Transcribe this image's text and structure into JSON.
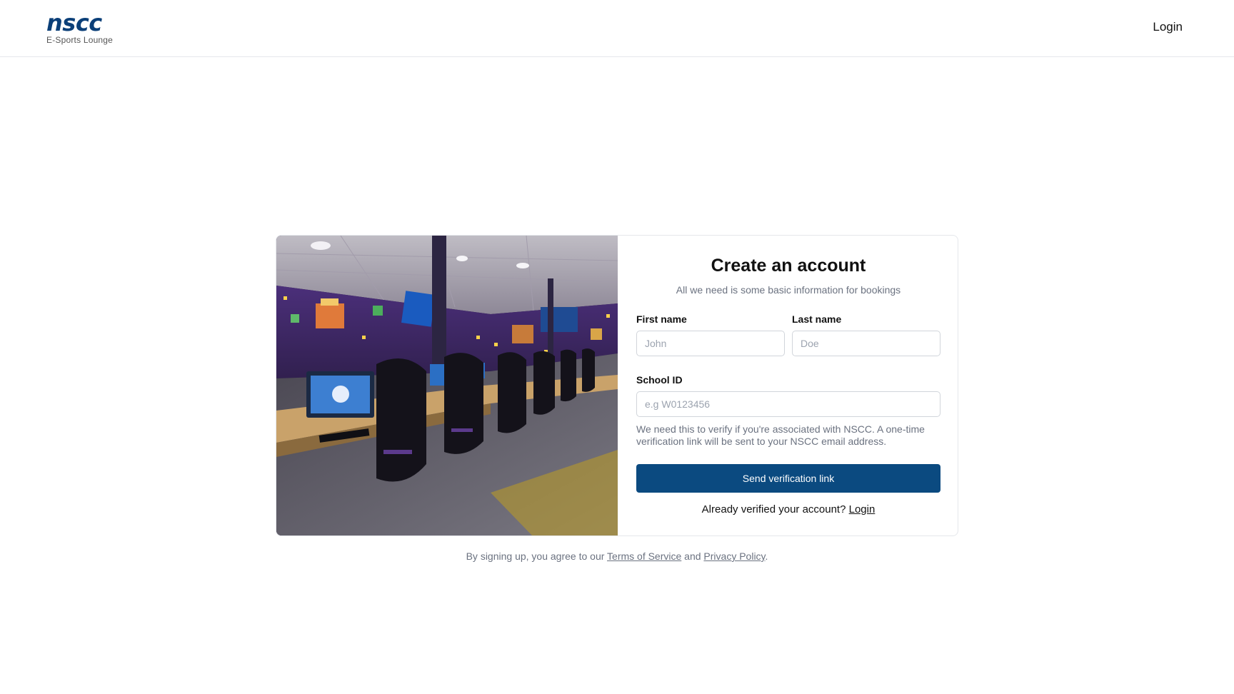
{
  "header": {
    "logo_text": "nscc",
    "logo_subtitle": "E-Sports Lounge",
    "login_label": "Login"
  },
  "hero_image": {
    "icon": "esports-lounge-photo"
  },
  "form": {
    "title": "Create an account",
    "subtitle": "All we need is some basic information for bookings",
    "first_name": {
      "label": "First name",
      "placeholder": "John",
      "value": ""
    },
    "last_name": {
      "label": "Last name",
      "placeholder": "Doe",
      "value": ""
    },
    "school_id": {
      "label": "School ID",
      "placeholder": "e.g W0123456",
      "value": "",
      "hint": "We need this to verify if you're associated with NSCC. A one-time verification link will be sent to your NSCC email address."
    },
    "submit_label": "Send verification link",
    "already_text": "Already verified your account?",
    "login_link": "Login"
  },
  "footer": {
    "prefix": "By signing up, you agree to our",
    "terms_link": "Terms of Service",
    "and": "and",
    "privacy_link": "Privacy Policy",
    "suffix": "."
  },
  "colors": {
    "brand": "#0b3f78",
    "primary_button": "#0b4a80",
    "muted_text": "#6b7280",
    "border": "#e5e7eb"
  }
}
